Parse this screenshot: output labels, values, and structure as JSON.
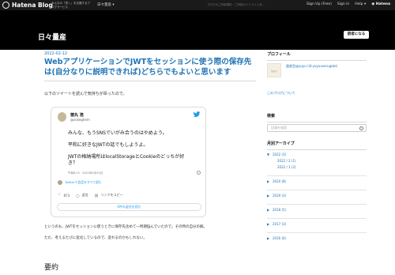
{
  "topbar": {
    "logo_text": "Hatena Blog",
    "tagline": "みんなの「書く」を応援するブログサービス",
    "menu_label": "日々量産",
    "notice": "ブログのご利用規約・ご利用ガイドラインを…",
    "links": [
      "Sign Up (Free)",
      "Sign in",
      "Help"
    ],
    "brand": "Hatena"
  },
  "header": {
    "blog_title": "日々量産",
    "reader_button": "読者になる"
  },
  "article": {
    "date": "2022-02-12",
    "title": "WebアプリケーションでJWTをセッションに使う際の保存先は(自分なりに説明できれば)どちらでもよいと思います",
    "intro": "以下のツイートを読んで気持ちが昂ったので。",
    "body1": "というのも、JWTをセッションに使うときに保存先含めて一時期悩んでいたので。その時の自分の解。",
    "body2": "ただ、考えるたびに変化しているので、変わるのかもしれない。",
    "summary_heading": "要約"
  },
  "tweet": {
    "name": "徳丸 浩",
    "handle": "@ockeghem",
    "lines": [
      "みんな、もうSNSでいがみ合うのはやめよう。",
      "平和に好きなJWTの話でもしようよ。",
      "JWTの格納場所はlocalStorageとCookieのどっちが好",
      "き？"
    ],
    "time": "午前6:15 · 2022年2月10日",
    "conversation_link": "Twitterで会話をすべて読む",
    "likes": "873",
    "reply_label": "返信",
    "copy_link_label": "リンクをコピー",
    "more_button": "4件の返信を読む"
  },
  "sidebar": {
    "profile": {
      "heading": "プロフィール",
      "name": "量産型@yuyu (id:yuyuuserugate)",
      "pic_text": "量産型",
      "about_link": "このブログについて"
    },
    "search": {
      "heading": "検索",
      "placeholder": "記事を検索"
    },
    "archive": {
      "heading": "月別アーカイブ",
      "items": [
        {
          "label": "2022 (3)",
          "expanded": true
        },
        {
          "label": "2022 / 2 (1)",
          "sub": true
        },
        {
          "label": "2022 / 1 (2)",
          "sub": true
        },
        {
          "label": "2020 (8)"
        },
        {
          "label": "2019 (3)"
        },
        {
          "label": "2018 (5)"
        },
        {
          "label": "2017 (3)"
        },
        {
          "label": "2016 (6)"
        }
      ]
    }
  },
  "colors": {
    "link": "#1d73b6",
    "header_bg": "#000000",
    "twitter_blue": "#1d9bf0"
  }
}
